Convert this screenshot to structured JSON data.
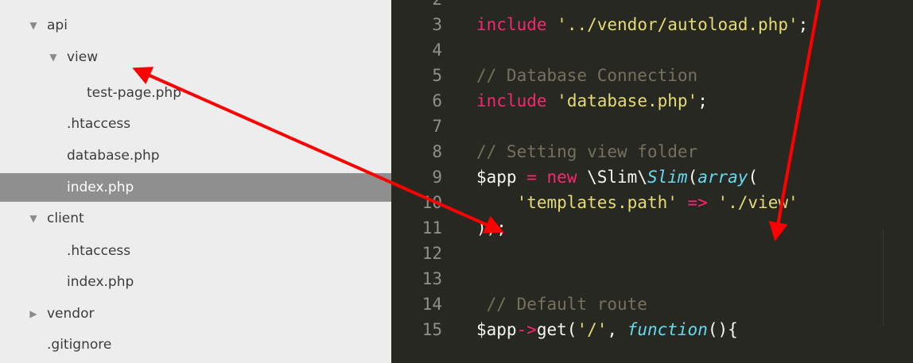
{
  "sidebar": {
    "items": [
      {
        "label": "api",
        "toggle": "expanded"
      },
      {
        "label": "view",
        "toggle": "expanded"
      },
      {
        "label": "test-page.php"
      },
      {
        "label": ".htaccess"
      },
      {
        "label": "database.php"
      },
      {
        "label": "index.php",
        "selected": true
      },
      {
        "label": "client",
        "toggle": "expanded"
      },
      {
        "label": ".htaccess"
      },
      {
        "label": "index.php"
      },
      {
        "label": "vendor",
        "toggle": "collapsed"
      },
      {
        "label": ".gitignore"
      }
    ]
  },
  "editor": {
    "lines": [
      {
        "number": "2",
        "tokens": []
      },
      {
        "number": "3",
        "tokens": [
          {
            "t": "kw",
            "v": "include"
          },
          {
            "t": "plain",
            "v": " "
          },
          {
            "t": "str",
            "v": "'../vendor/autoload.php'"
          },
          {
            "t": "plain",
            "v": ";"
          }
        ]
      },
      {
        "number": "4",
        "tokens": []
      },
      {
        "number": "5",
        "tokens": [
          {
            "t": "cmt",
            "v": "// Database Connection"
          }
        ]
      },
      {
        "number": "6",
        "tokens": [
          {
            "t": "kw",
            "v": "include"
          },
          {
            "t": "plain",
            "v": " "
          },
          {
            "t": "str",
            "v": "'database.php'"
          },
          {
            "t": "plain",
            "v": ";"
          }
        ]
      },
      {
        "number": "7",
        "tokens": []
      },
      {
        "number": "8",
        "tokens": [
          {
            "t": "cmt",
            "v": "// Setting view folder"
          }
        ]
      },
      {
        "number": "9",
        "tokens": [
          {
            "t": "plain",
            "v": "$app "
          },
          {
            "t": "kw",
            "v": "="
          },
          {
            "t": "plain",
            "v": " "
          },
          {
            "t": "kw",
            "v": "new"
          },
          {
            "t": "plain",
            "v": " \\Slim\\"
          },
          {
            "t": "cls",
            "v": "Slim"
          },
          {
            "t": "plain",
            "v": "("
          },
          {
            "t": "cls",
            "v": "array"
          },
          {
            "t": "plain",
            "v": "("
          }
        ]
      },
      {
        "number": "10",
        "tokens": [
          {
            "t": "plain",
            "v": "    "
          },
          {
            "t": "str",
            "v": "'templates.path'"
          },
          {
            "t": "plain",
            "v": " "
          },
          {
            "t": "kw",
            "v": "=>"
          },
          {
            "t": "plain",
            "v": " "
          },
          {
            "t": "str",
            "v": "'./view'"
          }
        ]
      },
      {
        "number": "11",
        "tokens": [
          {
            "t": "plain",
            "v": "));"
          }
        ]
      },
      {
        "number": "12",
        "tokens": []
      },
      {
        "number": "13",
        "tokens": []
      },
      {
        "number": "14",
        "tokens": [
          {
            "t": "plain",
            "v": " "
          },
          {
            "t": "cmt",
            "v": "// Default route"
          }
        ]
      },
      {
        "number": "15",
        "tokens": [
          {
            "t": "plain",
            "v": "$app"
          },
          {
            "t": "kw",
            "v": "->"
          },
          {
            "t": "plain",
            "v": "get("
          },
          {
            "t": "str",
            "v": "'/'"
          },
          {
            "t": "plain",
            "v": ", "
          },
          {
            "t": "cls",
            "v": "function"
          },
          {
            "t": "plain",
            "v": "(){"
          }
        ]
      }
    ]
  },
  "colors": {
    "sidebar_bg": "#ededed",
    "selected_row": "#8f8f8f",
    "editor_bg": "#272822",
    "keyword": "#f92672",
    "string": "#e6db74",
    "comment": "#75715e",
    "class": "#66d9ef",
    "annotation_arrow": "#ff0000"
  },
  "icons": {
    "expanded": "triangle-down-icon",
    "collapsed": "triangle-right-icon"
  }
}
